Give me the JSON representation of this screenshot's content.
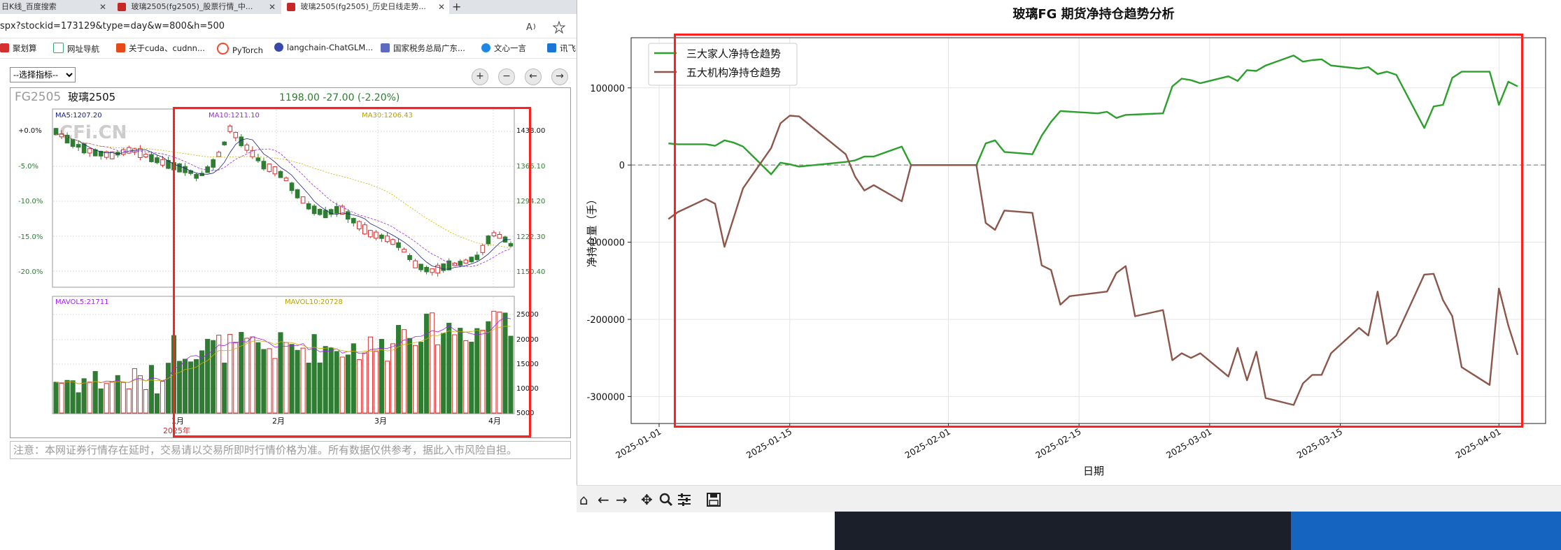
{
  "browser": {
    "tabs": [
      {
        "label": "日K线_百度搜索",
        "close": "✕"
      },
      {
        "label": "玻璃2505(fg2505)_股票行情_中...",
        "close": "✕"
      },
      {
        "label": "玻璃2505(fg2505)_历史日线走势...",
        "close": "✕"
      }
    ],
    "new_tab": "+",
    "url": "spx?stockid=173129&type=day&w=800&h=500",
    "bookmarks": [
      "聚划算",
      "网址导航",
      "关于cuda、cudnn...",
      "PyTorch",
      "langchain-ChatGLM...",
      "国家税务总局广东...",
      "文心一言",
      "讯飞"
    ]
  },
  "page": {
    "indicator_select": "--选择指标--",
    "nav_buttons": [
      "+",
      "−",
      "←",
      "→"
    ],
    "notice": "注意：本网证券行情存在延时，交易请以交易所即时行情价格为准。所有数据仅供参考，据此入市风险自担。"
  },
  "kline": {
    "code": "FG2505",
    "name": "玻璃2505",
    "quote": "1198.00  -27.00 (-2.20%)",
    "watermark": "CFi.CN",
    "ma5": "MA5:1207.20",
    "ma10": "MA10:1211.10",
    "ma30": "MA30:1206.43",
    "pct_ticks": [
      "+0.0%",
      "-5.0%",
      "-10.0%",
      "-15.0%",
      "-20.0%"
    ],
    "price_ticks": [
      "1438.00",
      "1366.10",
      "1294.20",
      "1222.30",
      "1150.40"
    ],
    "mavol5": "MAVOL5:21711",
    "mavol10": "MAVOL10:20728",
    "vol_ticks": [
      "25000",
      "20000",
      "15000",
      "10000",
      "5000"
    ],
    "month_labels": [
      "1月",
      "2月",
      "3月",
      "4月"
    ],
    "year_label": "2025年",
    "colors": {
      "up": "#d32f2f",
      "down": "#2e7d32"
    }
  },
  "chart_data": {
    "type": "line",
    "title": "玻璃FG 期货净持仓趋势分析",
    "xlabel": "日期",
    "ylabel": "净持仓量（手）",
    "x_ticks": [
      "2025-01-01",
      "2025-01-15",
      "2025-02-01",
      "2025-02-15",
      "2025-03-01",
      "2025-03-15",
      "2025-04-01"
    ],
    "y_ticks": [
      100000,
      0,
      -100000,
      -200000,
      -300000
    ],
    "xlim": [
      "2024-12-29",
      "2025-04-06"
    ],
    "ylim": [
      -335000,
      165000
    ],
    "grid": true,
    "legend": "top-left",
    "series": [
      {
        "name": "三大家人净持仓趋势",
        "color": "#2ca02c",
        "points": [
          [
            "2025-01-02",
            28000
          ],
          [
            "2025-01-03",
            27000
          ],
          [
            "2025-01-06",
            27000
          ],
          [
            "2025-01-07",
            25000
          ],
          [
            "2025-01-08",
            32000
          ],
          [
            "2025-01-09",
            29000
          ],
          [
            "2025-01-10",
            24000
          ],
          [
            "2025-01-13",
            -12000
          ],
          [
            "2025-01-14",
            3000
          ],
          [
            "2025-01-15",
            1000
          ],
          [
            "2025-01-16",
            -2000
          ],
          [
            "2025-01-21",
            4000
          ],
          [
            "2025-01-22",
            6000
          ],
          [
            "2025-01-23",
            11000
          ],
          [
            "2025-01-24",
            11000
          ],
          [
            "2025-01-27",
            24000
          ],
          [
            "2025-01-28",
            0
          ],
          [
            "2025-01-31",
            0
          ],
          [
            "2025-02-04",
            0
          ],
          [
            "2025-02-05",
            28000
          ],
          [
            "2025-02-06",
            32000
          ],
          [
            "2025-02-07",
            17000
          ],
          [
            "2025-02-10",
            14000
          ],
          [
            "2025-02-11",
            38000
          ],
          [
            "2025-02-12",
            56000
          ],
          [
            "2025-02-13",
            70000
          ],
          [
            "2025-02-17",
            67000
          ],
          [
            "2025-02-18",
            69000
          ],
          [
            "2025-02-19",
            61000
          ],
          [
            "2025-02-20",
            65000
          ],
          [
            "2025-02-24",
            67000
          ],
          [
            "2025-02-25",
            102000
          ],
          [
            "2025-02-26",
            112000
          ],
          [
            "2025-02-27",
            110000
          ],
          [
            "2025-02-28",
            106000
          ],
          [
            "2025-03-03",
            115000
          ],
          [
            "2025-03-04",
            109000
          ],
          [
            "2025-03-05",
            123000
          ],
          [
            "2025-03-06",
            122000
          ],
          [
            "2025-03-07",
            129000
          ],
          [
            "2025-03-10",
            142000
          ],
          [
            "2025-03-11",
            134000
          ],
          [
            "2025-03-12",
            136000
          ],
          [
            "2025-03-13",
            137000
          ],
          [
            "2025-03-14",
            129000
          ],
          [
            "2025-03-17",
            125000
          ],
          [
            "2025-03-18",
            127000
          ],
          [
            "2025-03-19",
            118000
          ],
          [
            "2025-03-20",
            121000
          ],
          [
            "2025-03-21",
            117000
          ],
          [
            "2025-03-24",
            48000
          ],
          [
            "2025-03-25",
            76000
          ],
          [
            "2025-03-26",
            78000
          ],
          [
            "2025-03-27",
            113000
          ],
          [
            "2025-03-28",
            121000
          ],
          [
            "2025-03-31",
            121000
          ],
          [
            "2025-04-01",
            78000
          ],
          [
            "2025-04-02",
            108000
          ],
          [
            "2025-04-03",
            102000
          ]
        ]
      },
      {
        "name": "五大机构净持仓趋势",
        "color": "#8c564b",
        "points": [
          [
            "2025-01-02",
            -70000
          ],
          [
            "2025-01-03",
            -61000
          ],
          [
            "2025-01-06",
            -44000
          ],
          [
            "2025-01-07",
            -50000
          ],
          [
            "2025-01-08",
            -106000
          ],
          [
            "2025-01-10",
            -30000
          ],
          [
            "2025-01-13",
            22000
          ],
          [
            "2025-01-14",
            54000
          ],
          [
            "2025-01-15",
            64000
          ],
          [
            "2025-01-16",
            63000
          ],
          [
            "2025-01-21",
            14000
          ],
          [
            "2025-01-22",
            -15000
          ],
          [
            "2025-01-23",
            -33000
          ],
          [
            "2025-01-24",
            -26000
          ],
          [
            "2025-01-27",
            -47000
          ],
          [
            "2025-01-28",
            0
          ],
          [
            "2025-01-31",
            0
          ],
          [
            "2025-02-04",
            0
          ],
          [
            "2025-02-05",
            -75000
          ],
          [
            "2025-02-06",
            -84000
          ],
          [
            "2025-02-07",
            -59000
          ],
          [
            "2025-02-10",
            -62000
          ],
          [
            "2025-02-11",
            -130000
          ],
          [
            "2025-02-12",
            -136000
          ],
          [
            "2025-02-13",
            -181000
          ],
          [
            "2025-02-14",
            -170000
          ],
          [
            "2025-02-18",
            -164000
          ],
          [
            "2025-02-19",
            -140000
          ],
          [
            "2025-02-20",
            -131000
          ],
          [
            "2025-02-21",
            -196000
          ],
          [
            "2025-02-24",
            -188000
          ],
          [
            "2025-02-25",
            -253000
          ],
          [
            "2025-02-26",
            -244000
          ],
          [
            "2025-02-27",
            -250000
          ],
          [
            "2025-02-28",
            -244000
          ],
          [
            "2025-03-03",
            -274000
          ],
          [
            "2025-03-04",
            -237000
          ],
          [
            "2025-03-05",
            -279000
          ],
          [
            "2025-03-06",
            -242000
          ],
          [
            "2025-03-07",
            -302000
          ],
          [
            "2025-03-10",
            -311000
          ],
          [
            "2025-03-11",
            -283000
          ],
          [
            "2025-03-12",
            -272000
          ],
          [
            "2025-03-13",
            -272000
          ],
          [
            "2025-03-14",
            -244000
          ],
          [
            "2025-03-17",
            -211000
          ],
          [
            "2025-03-18",
            -221000
          ],
          [
            "2025-03-19",
            -164000
          ],
          [
            "2025-03-20",
            -232000
          ],
          [
            "2025-03-21",
            -221000
          ],
          [
            "2025-03-24",
            -142000
          ],
          [
            "2025-03-25",
            -141000
          ],
          [
            "2025-03-26",
            -175000
          ],
          [
            "2025-03-27",
            -196000
          ],
          [
            "2025-03-28",
            -262000
          ],
          [
            "2025-03-31",
            -285000
          ],
          [
            "2025-04-01",
            -160000
          ],
          [
            "2025-04-02",
            -208000
          ],
          [
            "2025-04-03",
            -246000
          ]
        ]
      }
    ]
  },
  "toolbar": [
    "home-icon",
    "back-icon",
    "forward-icon",
    "pan-icon",
    "zoom-icon",
    "configure-icon",
    "save-icon"
  ],
  "colors": {
    "highlight": "#ff2020"
  }
}
